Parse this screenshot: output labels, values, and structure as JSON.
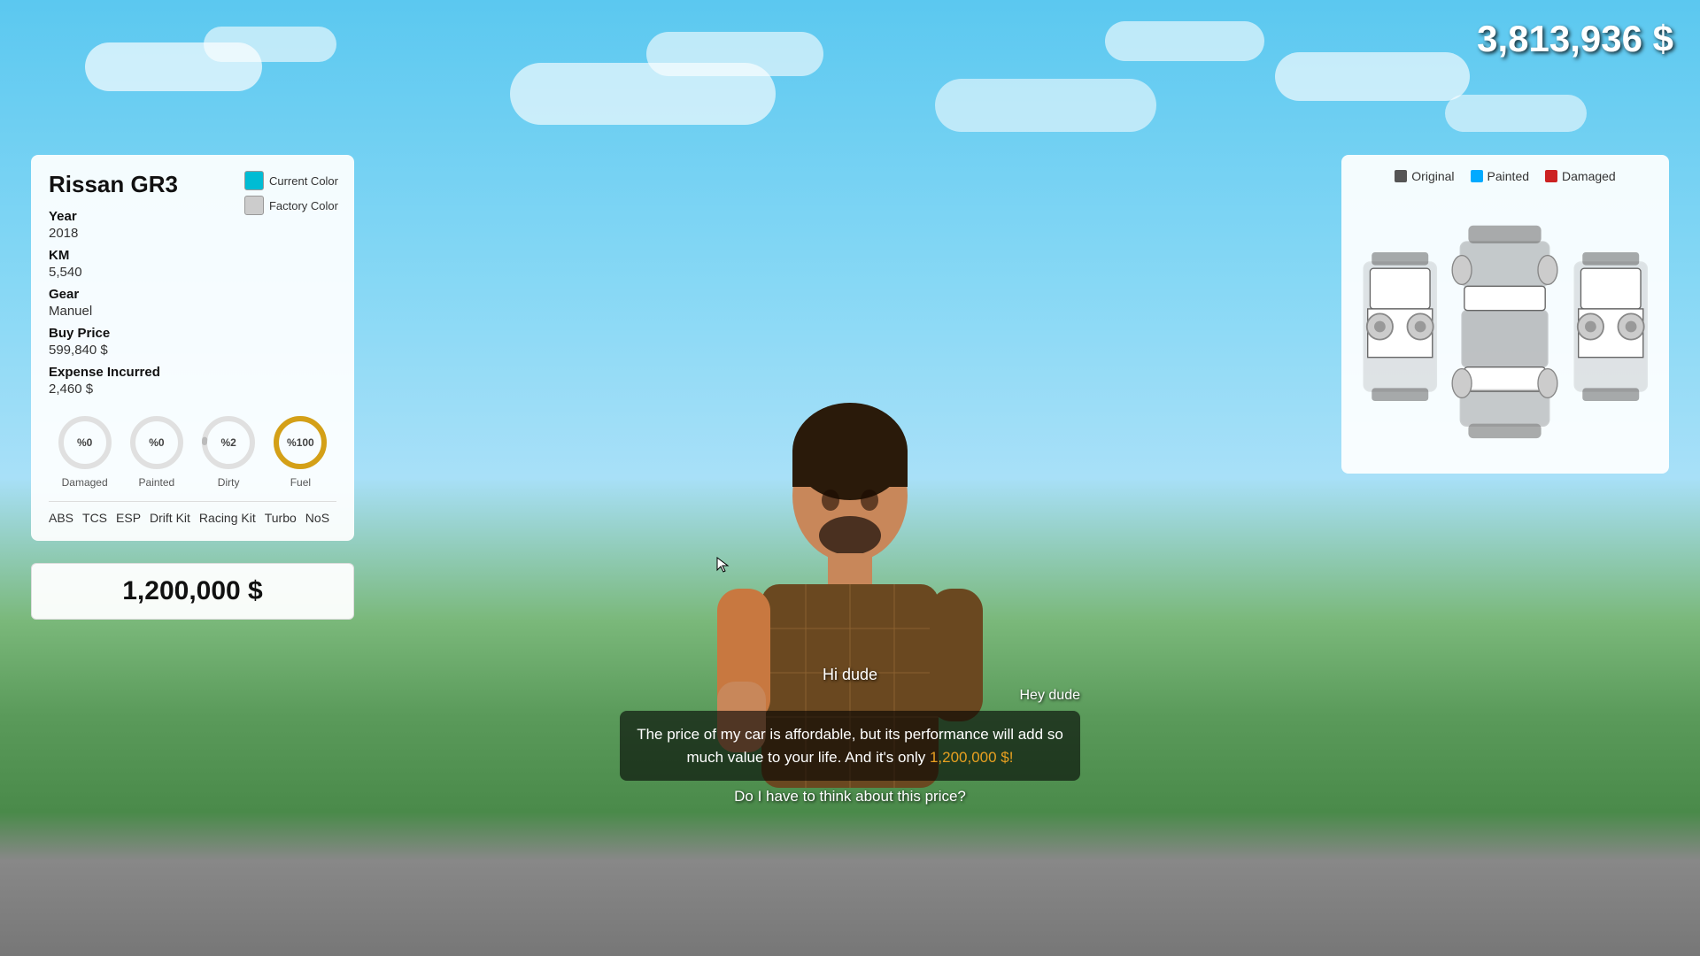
{
  "hud": {
    "money": "3,813,936 $"
  },
  "car": {
    "title": "Rissan GR3",
    "currentColorLabel": "Current Color",
    "factoryColorLabel": "Factory Color",
    "currentColor": "#00bcd4",
    "factoryColor": "#cccccc",
    "year_label": "Year",
    "year_value": "2018",
    "km_label": "KM",
    "km_value": "5,540",
    "gear_label": "Gear",
    "gear_value": "Manuel",
    "buy_price_label": "Buy Price",
    "buy_price_value": "599,840 $",
    "expense_label": "Expense Incurred",
    "expense_value": "2,460 $",
    "gauges": [
      {
        "id": "damaged",
        "label": "Damaged",
        "value": "0",
        "display": "%0",
        "color": "#aaa",
        "percent": 0
      },
      {
        "id": "painted",
        "label": "Painted",
        "value": "0",
        "display": "%0",
        "color": "#aaa",
        "percent": 0
      },
      {
        "id": "dirty",
        "label": "Dirty",
        "value": "2",
        "display": "%2",
        "color": "#bbb",
        "percent": 2
      },
      {
        "id": "fuel",
        "label": "Fuel",
        "value": "100",
        "display": "%100",
        "color": "#d4a017",
        "percent": 100
      }
    ],
    "features": [
      "ABS",
      "TCS",
      "ESP",
      "Drift Kit",
      "Racing Kit",
      "Turbo",
      "NoS"
    ],
    "sale_price": "1,200,000 $"
  },
  "diagram": {
    "legend": [
      {
        "label": "Original",
        "color": "#555"
      },
      {
        "label": "Painted",
        "color": "#00aaff"
      },
      {
        "label": "Damaged",
        "color": "#cc2222"
      }
    ]
  },
  "dialog": {
    "greeting": "Hi dude",
    "speaker": "Hey dude",
    "message": "The price of my car is affordable, but its performance will add so much value to your life. And it's only 1,200,000 $!",
    "highlight": "1,200,000 $!",
    "question": "Do I have to think about this price?"
  }
}
